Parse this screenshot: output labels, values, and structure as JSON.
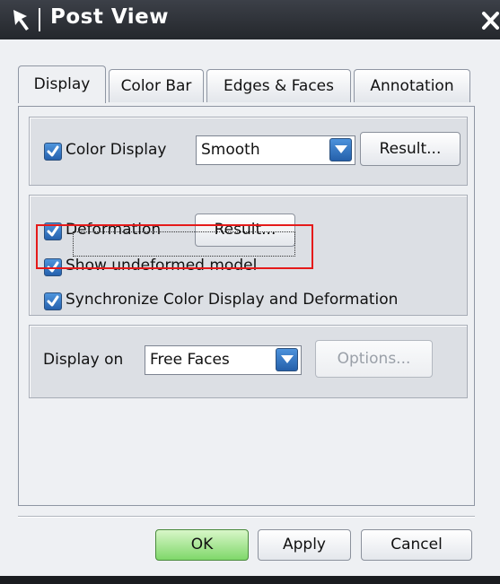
{
  "window": {
    "title": "Post View"
  },
  "tabs": [
    {
      "label": "Display",
      "active": true
    },
    {
      "label": "Color Bar",
      "active": false
    },
    {
      "label": "Edges & Faces",
      "active": false
    },
    {
      "label": "Annotation",
      "active": false
    }
  ],
  "display_group": {
    "color_display": {
      "label": "Color Display",
      "checked": true
    },
    "color_mode": {
      "value": "Smooth"
    },
    "result_button": "Result..."
  },
  "deformation_group": {
    "deformation": {
      "label": "Deformation",
      "checked": true
    },
    "result_button": "Result...",
    "show_undeformed": {
      "label": "Show undeformed model",
      "checked": true
    },
    "synchronize": {
      "label": "Synchronize Color Display and Deformation",
      "checked": true
    }
  },
  "display_on_group": {
    "label": "Display on",
    "value": "Free Faces",
    "options_button": "Options..."
  },
  "footer": {
    "ok": "OK",
    "apply": "Apply",
    "cancel": "Cancel"
  },
  "colors": {
    "accent": "#2a6ec0",
    "highlight": "#e51a1a",
    "ok_button": "#8ee07a"
  },
  "icons": [
    "pin-icon",
    "close-icon",
    "checkmark-icon",
    "dropdown-arrow-icon"
  ]
}
